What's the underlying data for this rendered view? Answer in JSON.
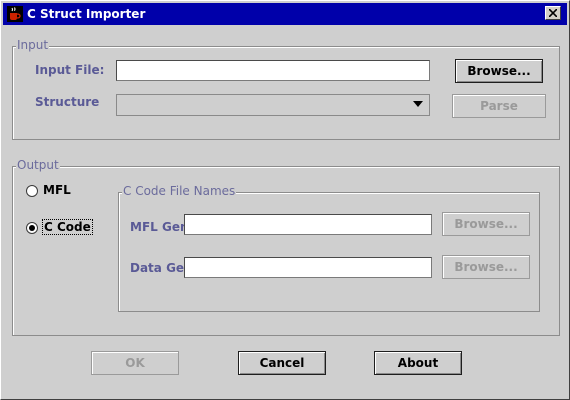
{
  "window": {
    "title": "C Struct Importer"
  },
  "input_group": {
    "legend": "Input",
    "input_file_label": "Input File:",
    "input_file_value": "",
    "browse_label": "Browse...",
    "structure_label": "Structure",
    "structure_value": "",
    "parse_label": "Parse"
  },
  "output_group": {
    "legend": "Output",
    "radio_mfl_label": "MFL",
    "radio_ccode_label": "C Code",
    "selected": "C Code",
    "cfile_group": {
      "legend": "C Code File Names",
      "mfl_gen_label": "MFL Gen:",
      "mfl_gen_value": "",
      "mfl_browse_label": "Browse...",
      "data_gen_label": "Data Gen:",
      "data_gen_value": "",
      "data_browse_label": "Browse..."
    }
  },
  "buttons": {
    "ok_label": "OK",
    "cancel_label": "Cancel",
    "about_label": "About"
  },
  "icons": {
    "app": "coffee-cup-icon",
    "close": "close-icon",
    "dropdown": "chevron-down-icon"
  },
  "colors": {
    "title_bar": "#0000aa",
    "window_bg": "#cfcfcf",
    "label_text": "#5a5a96"
  }
}
